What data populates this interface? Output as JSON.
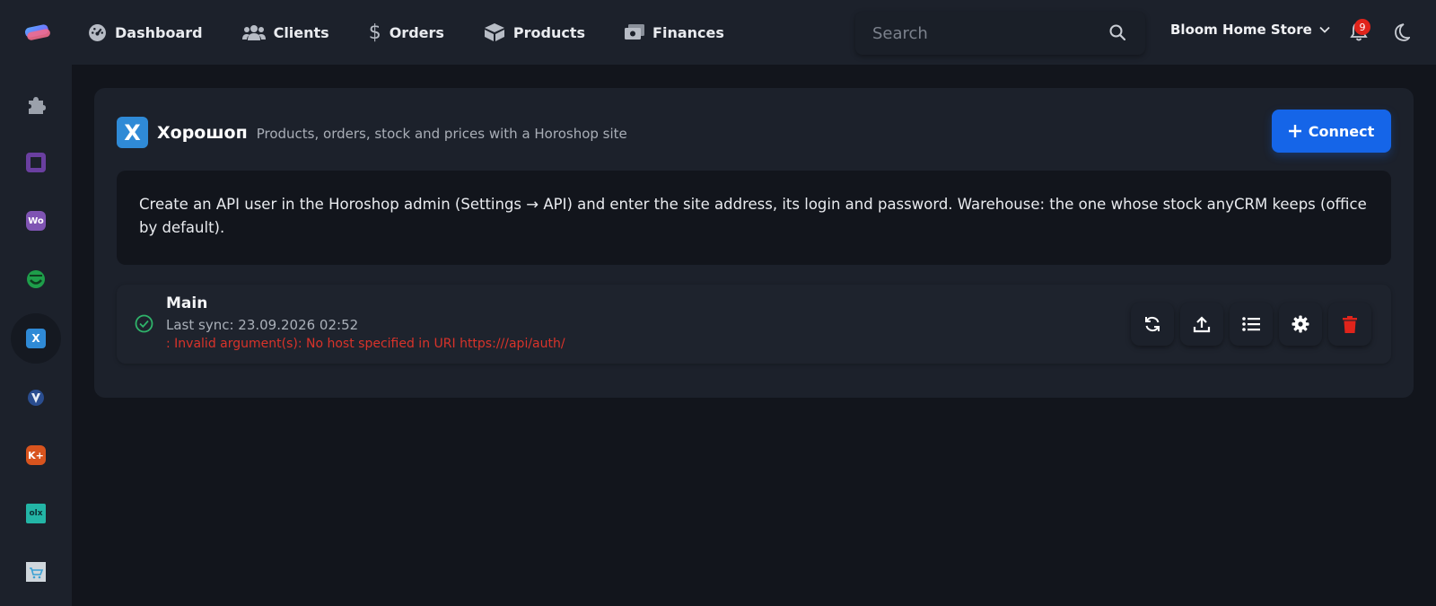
{
  "colors": {
    "accent": "#1565e8",
    "error": "#d9332a",
    "success": "#2fb36a",
    "badge": "#e0241b"
  },
  "header": {
    "nav": [
      {
        "label": "Dashboard",
        "icon": "gauge-icon"
      },
      {
        "label": "Clients",
        "icon": "users-icon"
      },
      {
        "label": "Orders",
        "icon": "dollar-icon"
      },
      {
        "label": "Products",
        "icon": "box-icon"
      },
      {
        "label": "Finances",
        "icon": "money-icon"
      }
    ],
    "search": {
      "placeholder": "Search",
      "value": ""
    },
    "store_name": "Bloom Home Store",
    "notifications_count": "9"
  },
  "sidebar": {
    "items": [
      {
        "icon": "puzzle-icon",
        "active": false
      },
      {
        "icon": "square-app-icon",
        "active": false
      },
      {
        "icon": "woocommerce-icon",
        "label": "Wo",
        "active": false
      },
      {
        "icon": "smile-app-icon",
        "active": false
      },
      {
        "icon": "horoshop-icon",
        "label": "X",
        "active": true
      },
      {
        "icon": "shield-app-icon",
        "active": false
      },
      {
        "icon": "kasta-icon",
        "label": "K+",
        "active": false
      },
      {
        "icon": "olx-icon",
        "label": "olx",
        "active": false
      },
      {
        "icon": "cart-app-icon",
        "active": false
      }
    ]
  },
  "integration": {
    "logo_letter": "X",
    "name": "Хорошоп",
    "description": "Products, orders, stock and prices with a Horoshop site",
    "connect_label": "Connect",
    "info_text": "Create an API user in the Horoshop admin (Settings → API) and enter the site address, its login and password. Warehouse: the one whose stock anyCRM keeps (office by default).",
    "connection": {
      "name": "Main",
      "last_sync": "Last sync: 23.09.2026 02:52",
      "error": ": Invalid argument(s): No host specified in URI https:///api/auth/"
    }
  }
}
